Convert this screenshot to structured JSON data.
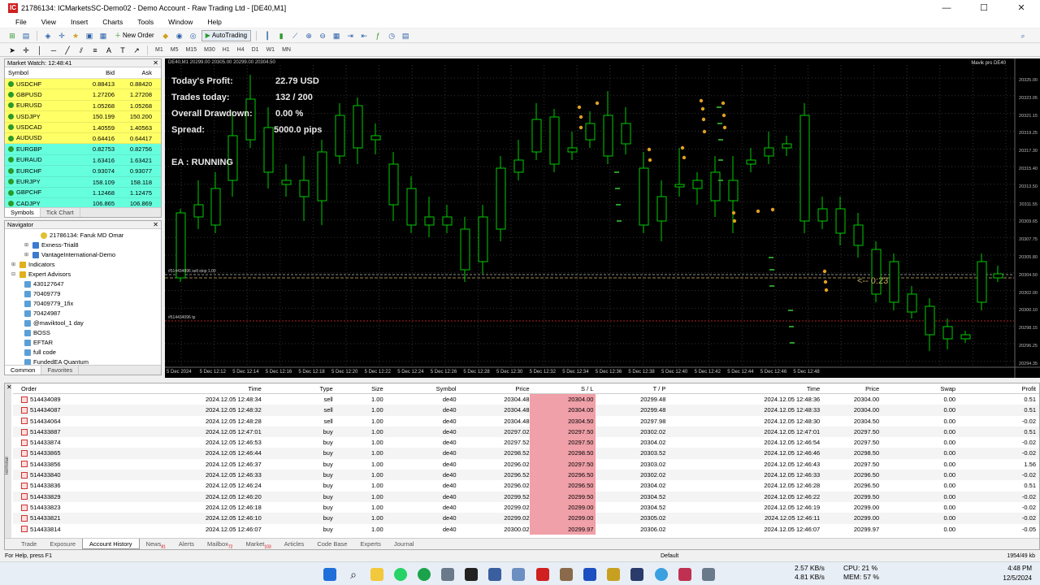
{
  "window": {
    "title": "21786134: ICMarketsSC-Demo02 - Demo Account - Raw Trading Ltd - [DE40,M1]",
    "app_icon": "IC"
  },
  "menu": [
    "File",
    "View",
    "Insert",
    "Charts",
    "Tools",
    "Window",
    "Help"
  ],
  "toolbar": {
    "new_order": "New Order",
    "autotrading": "AutoTrading"
  },
  "timeframes": [
    "M1",
    "M5",
    "M15",
    "M30",
    "H1",
    "H4",
    "D1",
    "W1",
    "MN"
  ],
  "market_watch": {
    "title": "Market Watch: 12:48:41",
    "headers": {
      "symbol": "Symbol",
      "bid": "Bid",
      "ask": "Ask"
    },
    "rows": [
      {
        "symbol": "USDCHF",
        "bid": "0.88413",
        "ask": "0.88420"
      },
      {
        "symbol": "GBPUSD",
        "bid": "1.27206",
        "ask": "1.27208"
      },
      {
        "symbol": "EURUSD",
        "bid": "1.05268",
        "ask": "1.05268"
      },
      {
        "symbol": "USDJPY",
        "bid": "150.199",
        "ask": "150.200"
      },
      {
        "symbol": "USDCAD",
        "bid": "1.40559",
        "ask": "1.40563"
      },
      {
        "symbol": "AUDUSD",
        "bid": "0.64416",
        "ask": "0.64417"
      },
      {
        "symbol": "EURGBP",
        "bid": "0.82753",
        "ask": "0.82756"
      },
      {
        "symbol": "EURAUD",
        "bid": "1.63416",
        "ask": "1.63421"
      },
      {
        "symbol": "EURCHF",
        "bid": "0.93074",
        "ask": "0.93077"
      },
      {
        "symbol": "EURJPY",
        "bid": "158.109",
        "ask": "158.118"
      },
      {
        "symbol": "GBPCHF",
        "bid": "1.12468",
        "ask": "1.12475"
      },
      {
        "symbol": "CADJPY",
        "bid": "106.865",
        "ask": "106.869"
      }
    ],
    "tabs": [
      "Symbols",
      "Tick Chart"
    ]
  },
  "navigator": {
    "title": "Navigator",
    "items": [
      {
        "label": "21786134: Faruk MD Omar",
        "indent": 44,
        "icon": "user"
      },
      {
        "label": "Exness-Trial8",
        "indent": 24,
        "icon": "acc"
      },
      {
        "label": "VantageInternational-Demo",
        "indent": 24,
        "icon": "acc"
      },
      {
        "label": "Indicators",
        "indent": 8,
        "icon": "ind"
      },
      {
        "label": "Expert Advisors",
        "indent": 8,
        "icon": "ind"
      },
      {
        "label": "430127647",
        "indent": 24,
        "icon": "ea"
      },
      {
        "label": "70409779",
        "indent": 24,
        "icon": "ea"
      },
      {
        "label": "70409779_1fix",
        "indent": 24,
        "icon": "ea"
      },
      {
        "label": "70424987",
        "indent": 24,
        "icon": "ea"
      },
      {
        "label": "@maviktool_1 day",
        "indent": 24,
        "icon": "ea"
      },
      {
        "label": "BOSS",
        "indent": 24,
        "icon": "ea"
      },
      {
        "label": "EFTAR",
        "indent": 24,
        "icon": "ea"
      },
      {
        "label": "full code",
        "indent": 24,
        "icon": "ea"
      },
      {
        "label": "FundedEA Quantum",
        "indent": 24,
        "icon": "ea"
      }
    ],
    "tabs": [
      "Common",
      "Favorites"
    ]
  },
  "chart": {
    "header": "DE40,M1  20299.00 20305.00 20299.00 20304.50",
    "ea_label": "Mavik pro DE40",
    "overlay": [
      {
        "label": "Today's Profit:",
        "value": "22.79 USD"
      },
      {
        "label": "Trades today:",
        "value": "132 / 200"
      },
      {
        "label": "Overall Drawdown:",
        "value": "0.00 %"
      },
      {
        "label": "Spread:",
        "value": "5000.0 pips"
      }
    ],
    "status": "EA : RUNNING",
    "timer": "<-- 0:23",
    "stop_label": "#514434096 sell stop 1.00",
    "tp_label": "#514434096 tp",
    "price_labels": [
      "20325.00",
      "20323.05",
      "20321.15",
      "20319.25",
      "20317.30",
      "20315.40",
      "20313.50",
      "20311.55",
      "20309.65",
      "20307.75",
      "20305.80",
      "20304.50",
      "20302.00",
      "20300.10",
      "20298.15",
      "20296.25",
      "20294.35"
    ],
    "time_labels": [
      "5 Dec 2024",
      "5 Dec 12:12",
      "5 Dec 12:14",
      "5 Dec 12:16",
      "5 Dec 12:18",
      "5 Dec 12:20",
      "5 Dec 12:22",
      "5 Dec 12:24",
      "5 Dec 12:26",
      "5 Dec 12:28",
      "5 Dec 12:30",
      "5 Dec 12:32",
      "5 Dec 12:34",
      "5 Dec 12:36",
      "5 Dec 12:38",
      "5 Dec 12:40",
      "5 Dec 12:42",
      "5 Dec 12:44",
      "5 Dec 12:46",
      "5 Dec 12:48"
    ]
  },
  "history": {
    "headers": [
      "Order",
      "Time",
      "Type",
      "Size",
      "Symbol",
      "Price",
      "S / L",
      "T / P",
      "Time",
      "Price",
      "Swap",
      "Profit"
    ],
    "rows": [
      [
        "514434089",
        "2024.12.05 12:48:34",
        "sell",
        "1.00",
        "de40",
        "20304.48",
        "20304.00",
        "20299.48",
        "2024.12.05 12:48:36",
        "20304.00",
        "0.00",
        "0.51"
      ],
      [
        "514434087",
        "2024.12.05 12:48:32",
        "sell",
        "1.00",
        "de40",
        "20304.48",
        "20304.00",
        "20299.48",
        "2024.12.05 12:48:33",
        "20304.00",
        "0.00",
        "0.51"
      ],
      [
        "514434064",
        "2024.12.05 12:48:28",
        "sell",
        "1.00",
        "de40",
        "20304.48",
        "20304.50",
        "20297.98",
        "2024.12.05 12:48:30",
        "20304.50",
        "0.00",
        "-0.02"
      ],
      [
        "514433887",
        "2024.12.05 12:47:01",
        "buy",
        "1.00",
        "de40",
        "20297.02",
        "20297.50",
        "20302.02",
        "2024.12.05 12:47:01",
        "20297.50",
        "0.00",
        "0.51"
      ],
      [
        "514433874",
        "2024.12.05 12:46:53",
        "buy",
        "1.00",
        "de40",
        "20297.52",
        "20297.50",
        "20304.02",
        "2024.12.05 12:46:54",
        "20297.50",
        "0.00",
        "-0.02"
      ],
      [
        "514433865",
        "2024.12.05 12:46:44",
        "buy",
        "1.00",
        "de40",
        "20298.52",
        "20298.50",
        "20303.52",
        "2024.12.05 12:46:46",
        "20298.50",
        "0.00",
        "-0.02"
      ],
      [
        "514433856",
        "2024.12.05 12:46:37",
        "buy",
        "1.00",
        "de40",
        "20296.02",
        "20297.50",
        "20303.02",
        "2024.12.05 12:46:43",
        "20297.50",
        "0.00",
        "1.56"
      ],
      [
        "514433840",
        "2024.12.05 12:46:33",
        "buy",
        "1.00",
        "de40",
        "20296.52",
        "20296.50",
        "20302.02",
        "2024.12.05 12:46:33",
        "20296.50",
        "0.00",
        "-0.02"
      ],
      [
        "514433836",
        "2024.12.05 12:46:24",
        "buy",
        "1.00",
        "de40",
        "20296.02",
        "20296.50",
        "20304.02",
        "2024.12.05 12:46:28",
        "20296.50",
        "0.00",
        "0.51"
      ],
      [
        "514433829",
        "2024.12.05 12:46:20",
        "buy",
        "1.00",
        "de40",
        "20299.52",
        "20299.50",
        "20304.52",
        "2024.12.05 12:46:22",
        "20299.50",
        "0.00",
        "-0.02"
      ],
      [
        "514433823",
        "2024.12.05 12:46:18",
        "buy",
        "1.00",
        "de40",
        "20299.02",
        "20299.00",
        "20304.52",
        "2024.12.05 12:46:19",
        "20299.00",
        "0.00",
        "-0.02"
      ],
      [
        "514433821",
        "2024.12.05 12:46:10",
        "buy",
        "1.00",
        "de40",
        "20299.02",
        "20299.00",
        "20305.02",
        "2024.12.05 12:46:11",
        "20299.00",
        "0.00",
        "-0.02"
      ],
      [
        "514433814",
        "2024.12.05 12:46:07",
        "buy",
        "1.00",
        "de40",
        "20300.02",
        "20299.97",
        "20306.02",
        "2024.12.05 12:46:07",
        "20299.97",
        "0.00",
        "-0.05"
      ]
    ],
    "side_label": "Terminal",
    "tabs": [
      {
        "label": "Trade",
        "badge": ""
      },
      {
        "label": "Exposure",
        "badge": ""
      },
      {
        "label": "Account History",
        "badge": ""
      },
      {
        "label": "News",
        "badge": "81"
      },
      {
        "label": "Alerts",
        "badge": ""
      },
      {
        "label": "Mailbox",
        "badge": "72"
      },
      {
        "label": "Market",
        "badge": "103"
      },
      {
        "label": "Articles",
        "badge": ""
      },
      {
        "label": "Code Base",
        "badge": ""
      },
      {
        "label": "Experts",
        "badge": ""
      },
      {
        "label": "Journal",
        "badge": ""
      }
    ]
  },
  "statusbar": {
    "help": "For Help, press F1",
    "profile": "Default",
    "net": "1954/49 kb"
  },
  "tray": {
    "up": "2.57 KB/s",
    "down": "4.81 KB/s",
    "cpu": "CPU: 21 %",
    "mem": "MEM: 57 %",
    "time": "4:48 PM",
    "date": "12/5/2024"
  },
  "colors": {
    "bull_candle": "#ffffff",
    "wick": "#00cc00",
    "sl_highlight": "#f0a0a8",
    "chart_bg": "#000000"
  }
}
